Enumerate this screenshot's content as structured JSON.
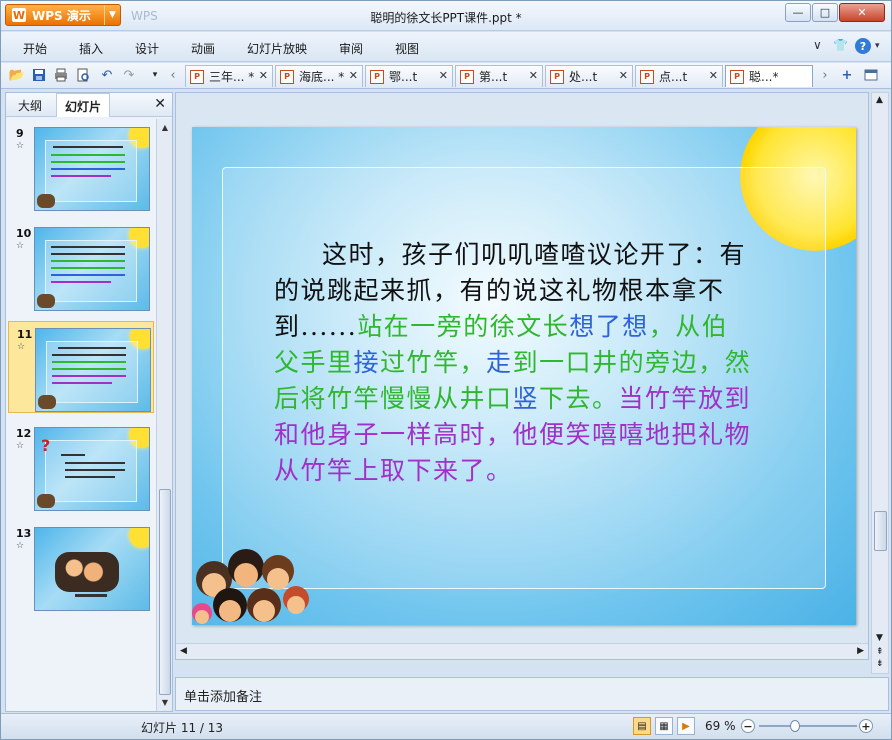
{
  "app": {
    "wps_button": "WPS 演示",
    "ghost_label": "WPS",
    "doc_title": "聪明的徐文长PPT课件.ppt *",
    "window_controls": [
      "—",
      "□",
      "✕"
    ]
  },
  "menu": {
    "items": [
      "开始",
      "插入",
      "设计",
      "动画",
      "幻灯片放映",
      "审阅",
      "视图"
    ]
  },
  "tabs": [
    {
      "label": "三年... *",
      "active": false
    },
    {
      "label": "海底... *",
      "active": false
    },
    {
      "label": "鄂...t",
      "active": false
    },
    {
      "label": "第...t",
      "active": false
    },
    {
      "label": "处...t",
      "active": false
    },
    {
      "label": "点...t",
      "active": false
    },
    {
      "label": "聪...*",
      "active": true
    }
  ],
  "left_pane": {
    "tab_outline": "大纲",
    "tab_slides": "幻灯片",
    "close": "✕",
    "thumbnails": [
      {
        "num": "9",
        "star": "☆",
        "selected": false
      },
      {
        "num": "10",
        "star": "☆",
        "selected": false
      },
      {
        "num": "11",
        "star": "☆",
        "selected": true
      },
      {
        "num": "12",
        "star": "☆",
        "selected": false
      },
      {
        "num": "13",
        "star": "☆",
        "selected": false
      }
    ]
  },
  "slide": {
    "seg1": "这时，孩子们叽叽喳喳议论开了：有的说跳起来抓，有的说这礼物根本拿不到......",
    "seg2": "站在一旁的徐文长",
    "seg3": "想了想",
    "seg4": "，从伯父手里",
    "seg5": "接",
    "seg6": "过竹竿，",
    "seg7": "走",
    "seg8": "到一口井的旁边，然后将竹竿慢慢从井口",
    "seg9": "竖",
    "seg10": "下去。",
    "seg11": "当竹竿放到和他身子一样高时，他便笑嘻嘻地把礼物从竹竿上取下来了。"
  },
  "notes": {
    "placeholder": "单击添加备注"
  },
  "status": {
    "slide_position": "幻灯片 11 / 13",
    "zoom": "69 %",
    "zoom_level": 0.35
  },
  "colors": {
    "accent_orange": "#ea7200",
    "text_green": "#2fb82f",
    "text_blue": "#2d63d8",
    "text_purple": "#a030c8"
  }
}
